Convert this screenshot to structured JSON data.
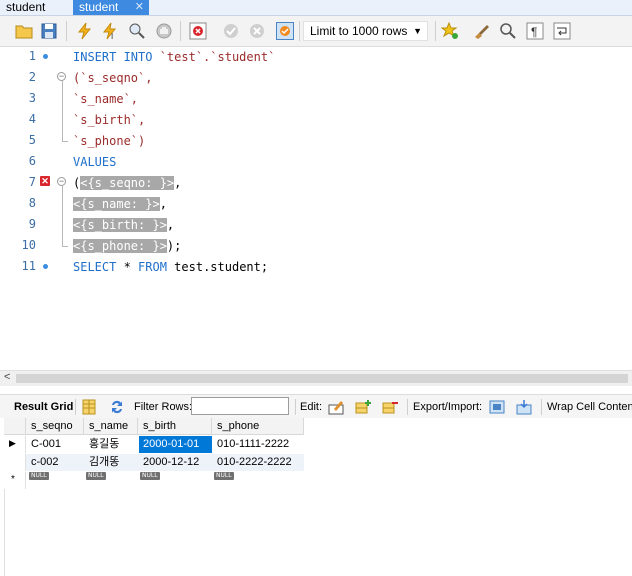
{
  "tabs": [
    {
      "label": "student",
      "active": false
    },
    {
      "label": "student",
      "active": true
    }
  ],
  "toolbar": {
    "limit_label": "Limit to 1000 rows",
    "icons": [
      "open-folder-icon",
      "save-icon",
      "execute-icon",
      "execute-statement-icon",
      "find-icon",
      "stop-icon",
      "toggle-error-icon",
      "commit-icon",
      "rollback-icon",
      "auto-commit-icon",
      "beautify-icon",
      "bookmark-star-icon",
      "brush-icon",
      "search-icon",
      "pilcrow-icon",
      "wrap-icon"
    ]
  },
  "editor": {
    "line_numbers": [
      "1",
      "2",
      "3",
      "4",
      "5",
      "6",
      "7",
      "8",
      "9",
      "10",
      "11"
    ],
    "lines": [
      {
        "kw1": "INSERT INTO",
        "rest": " `test`.`student`"
      },
      {
        "text": "(`s_seqno`,"
      },
      {
        "text": "`s_name`,"
      },
      {
        "text": "`s_birth`,"
      },
      {
        "text": "`s_phone`)"
      },
      {
        "kw": "VALUES"
      },
      {
        "pre": "(",
        "hl": "<{s_seqno: }>",
        "post": ","
      },
      {
        "hl": "<{s_name: }>",
        "post": ","
      },
      {
        "hl": "<{s_birth: }>",
        "post": ","
      },
      {
        "hl": "<{s_phone: }>",
        "post": ");"
      },
      {
        "kw1": "SELECT",
        "mid": " * ",
        "kw2": "FROM",
        "rest": " test.student;"
      }
    ]
  },
  "result_toolbar": {
    "result_grid": "Result Grid",
    "filter_rows": "Filter Rows:",
    "filter_value": "",
    "edit": "Edit:",
    "export_import": "Export/Import:",
    "wrap": "Wrap Cell Content:"
  },
  "grid": {
    "columns": [
      "s_seqno",
      "s_name",
      "s_birth",
      "s_phone"
    ],
    "rows": [
      [
        "C-001",
        "홍길동",
        "2000-01-01",
        "010-1111-2222"
      ],
      [
        "c-002",
        "김개똥",
        "2000-12-12",
        "010-2222-2222"
      ]
    ],
    "null_label": "NULL",
    "new_row_marker": "*",
    "current_row_marker": "▶"
  },
  "colors": {
    "accent": "#3d8ae0",
    "keyword": "#1f6fc9",
    "identifier": "#9b2b2b",
    "selection": "#0078d7"
  }
}
